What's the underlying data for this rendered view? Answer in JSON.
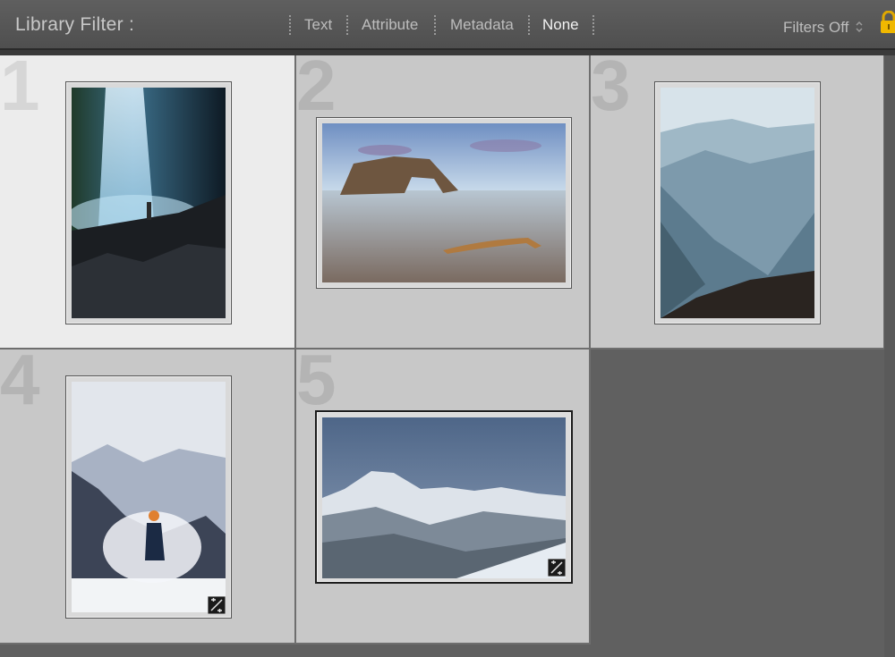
{
  "filter_bar": {
    "title": "Library Filter :",
    "tabs": [
      {
        "label": "Text",
        "active": false
      },
      {
        "label": "Attribute",
        "active": false
      },
      {
        "label": "Metadata",
        "active": false
      },
      {
        "label": "None",
        "active": true
      }
    ],
    "filters_status": "Filters Off"
  },
  "grid": {
    "cells": [
      {
        "index": "1",
        "subject": "waterfall with hiker on rocks",
        "selected": true,
        "badge": false
      },
      {
        "index": "2",
        "subject": "sea arch at beach with driftwood",
        "selected": false,
        "badge": false
      },
      {
        "index": "3",
        "subject": "misty blue mountain ridges with hiker",
        "selected": false,
        "badge": false
      },
      {
        "index": "4",
        "subject": "runner in snow by mountains",
        "selected": false,
        "badge": true
      },
      {
        "index": "5",
        "subject": "snowy mountain over forest",
        "selected": false,
        "badge": true
      }
    ]
  },
  "colors": {
    "selected_cell": "#ececec",
    "cell": "#c8c8c8",
    "background": "#606060"
  }
}
